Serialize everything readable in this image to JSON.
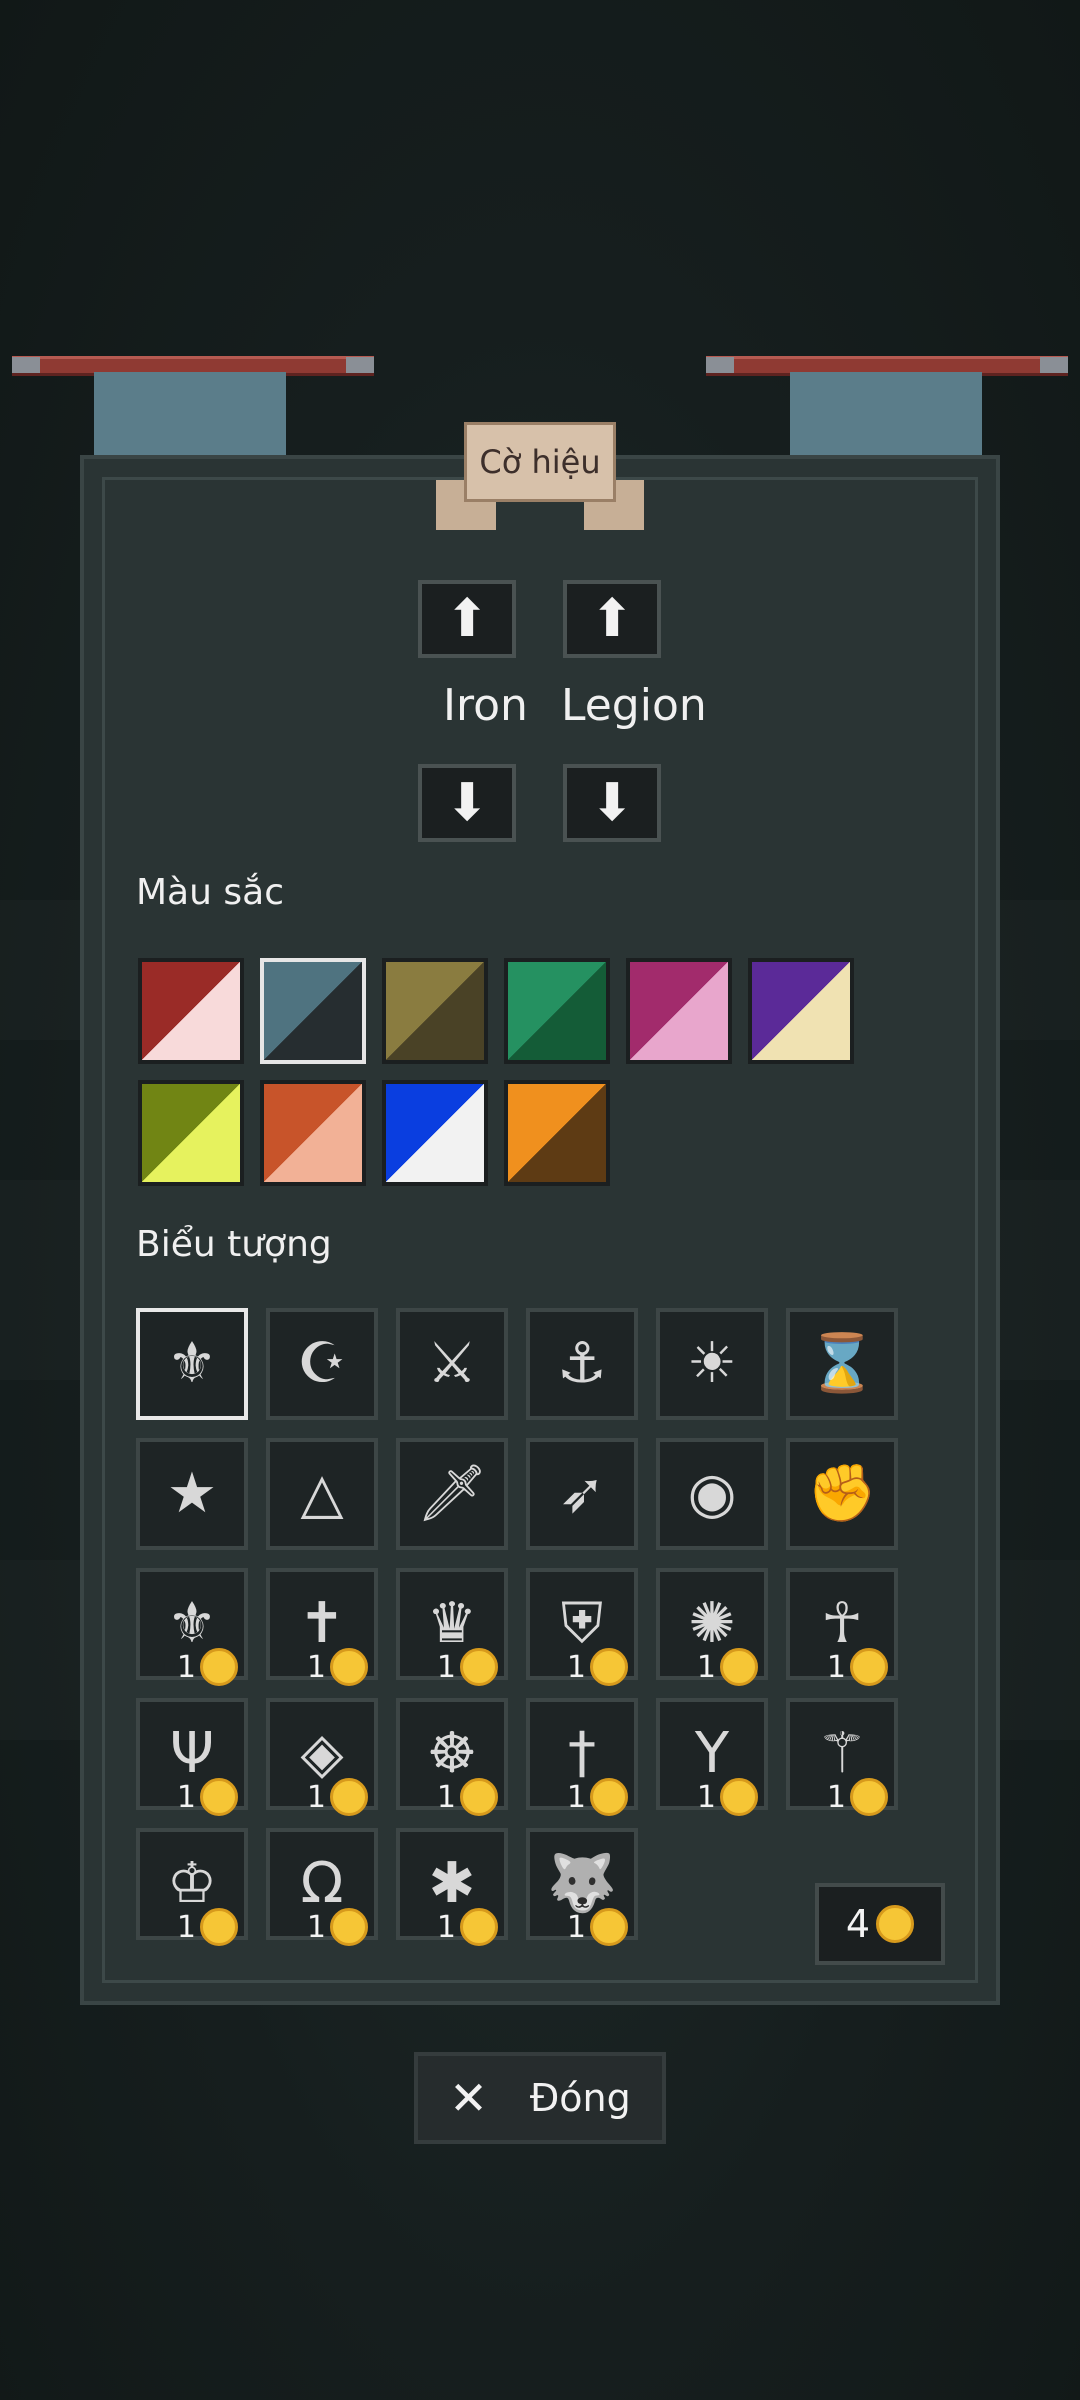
{
  "banner": {
    "title": "Cờ hiệu",
    "name_left": "Iron",
    "name_right": "Legion"
  },
  "colors": {
    "label": "Màu sắc",
    "swatches": [
      {
        "top": "#9a2b27",
        "bottom": "#f8dada"
      },
      {
        "top": "#4f7380",
        "bottom": "#262d30"
      },
      {
        "top": "#8a7c40",
        "bottom": "#4a4226"
      },
      {
        "top": "#259161",
        "bottom": "#145c37"
      },
      {
        "top": "#a22b6c",
        "bottom": "#e8a6cc"
      },
      {
        "top": "#5b2a98",
        "bottom": "#f0e2b2"
      },
      {
        "top": "#718514",
        "bottom": "#e6f25e"
      },
      {
        "top": "#c8542a",
        "bottom": "#f2b196"
      },
      {
        "top": "#0a3ee0",
        "bottom": "#f2f2f2"
      },
      {
        "top": "#f0901e",
        "bottom": "#5e3b14"
      }
    ],
    "selected_index": 1
  },
  "emblems": {
    "label": "Biểu tượng",
    "items": [
      {
        "icon": "winged-crest-icon"
      },
      {
        "icon": "crescent-star-icon"
      },
      {
        "icon": "crossed-swords-icon"
      },
      {
        "icon": "anchor-sun-icon"
      },
      {
        "icon": "sunburst-icon"
      },
      {
        "icon": "hourglass-icon"
      },
      {
        "icon": "star-icon"
      },
      {
        "icon": "triangle-eye-icon"
      },
      {
        "icon": "sword-icon"
      },
      {
        "icon": "bow-arrow-icon"
      },
      {
        "icon": "discord-icon"
      },
      {
        "icon": "fist-icon"
      },
      {
        "icon": "fleur-de-lis-icon",
        "cost": "1"
      },
      {
        "icon": "cross-icon",
        "cost": "1"
      },
      {
        "icon": "crown-icon",
        "cost": "1"
      },
      {
        "icon": "shield-icon",
        "cost": "1"
      },
      {
        "icon": "web-icon",
        "cost": "1"
      },
      {
        "icon": "ankh-icon",
        "cost": "1"
      },
      {
        "icon": "trident-icon",
        "cost": "1"
      },
      {
        "icon": "diamond-icon",
        "cost": "1"
      },
      {
        "icon": "wheel-icon",
        "cost": "1"
      },
      {
        "icon": "dagger-icon",
        "cost": "1"
      },
      {
        "icon": "branch-icon",
        "cost": "1"
      },
      {
        "icon": "staff-icon",
        "cost": "1"
      },
      {
        "icon": "small-crown-icon",
        "cost": "1"
      },
      {
        "icon": "horseshoe-icon",
        "cost": "1"
      },
      {
        "icon": "spider-icon",
        "cost": "1"
      },
      {
        "icon": "wolf-head-icon",
        "cost": "1"
      }
    ],
    "selected_index": 0
  },
  "coins": {
    "balance": "4"
  },
  "close": {
    "label": "Đóng"
  }
}
